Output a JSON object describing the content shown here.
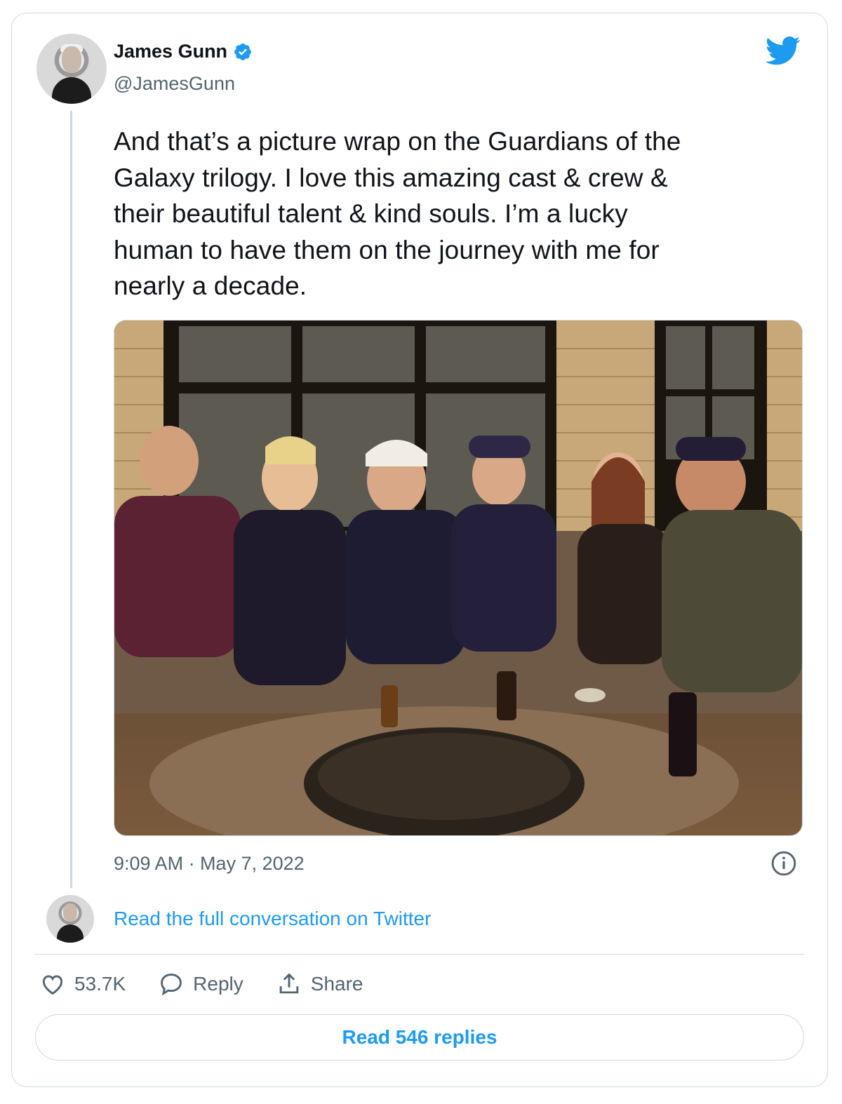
{
  "author": {
    "name": "James Gunn",
    "handle": "@JamesGunn",
    "verified": true
  },
  "tweet": {
    "text": "And that’s a picture wrap on the Guardians of the\nGalaxy trilogy. I love this amazing cast & crew &\ntheir beautiful talent & kind souls. I’m a lucky\nhuman to have them on the journey with me for\nnearly a decade.",
    "timestamp": "9:09 AM · May 7, 2022"
  },
  "conversation": {
    "link_label": "Read the full conversation on Twitter"
  },
  "actions": {
    "like_count": "53.7K",
    "reply_label": "Reply",
    "share_label": "Share"
  },
  "footer": {
    "read_replies_label": "Read 546 replies"
  },
  "colors": {
    "accent": "#1d9bf0",
    "secondary_text": "#536471",
    "border": "#cfd9de"
  }
}
